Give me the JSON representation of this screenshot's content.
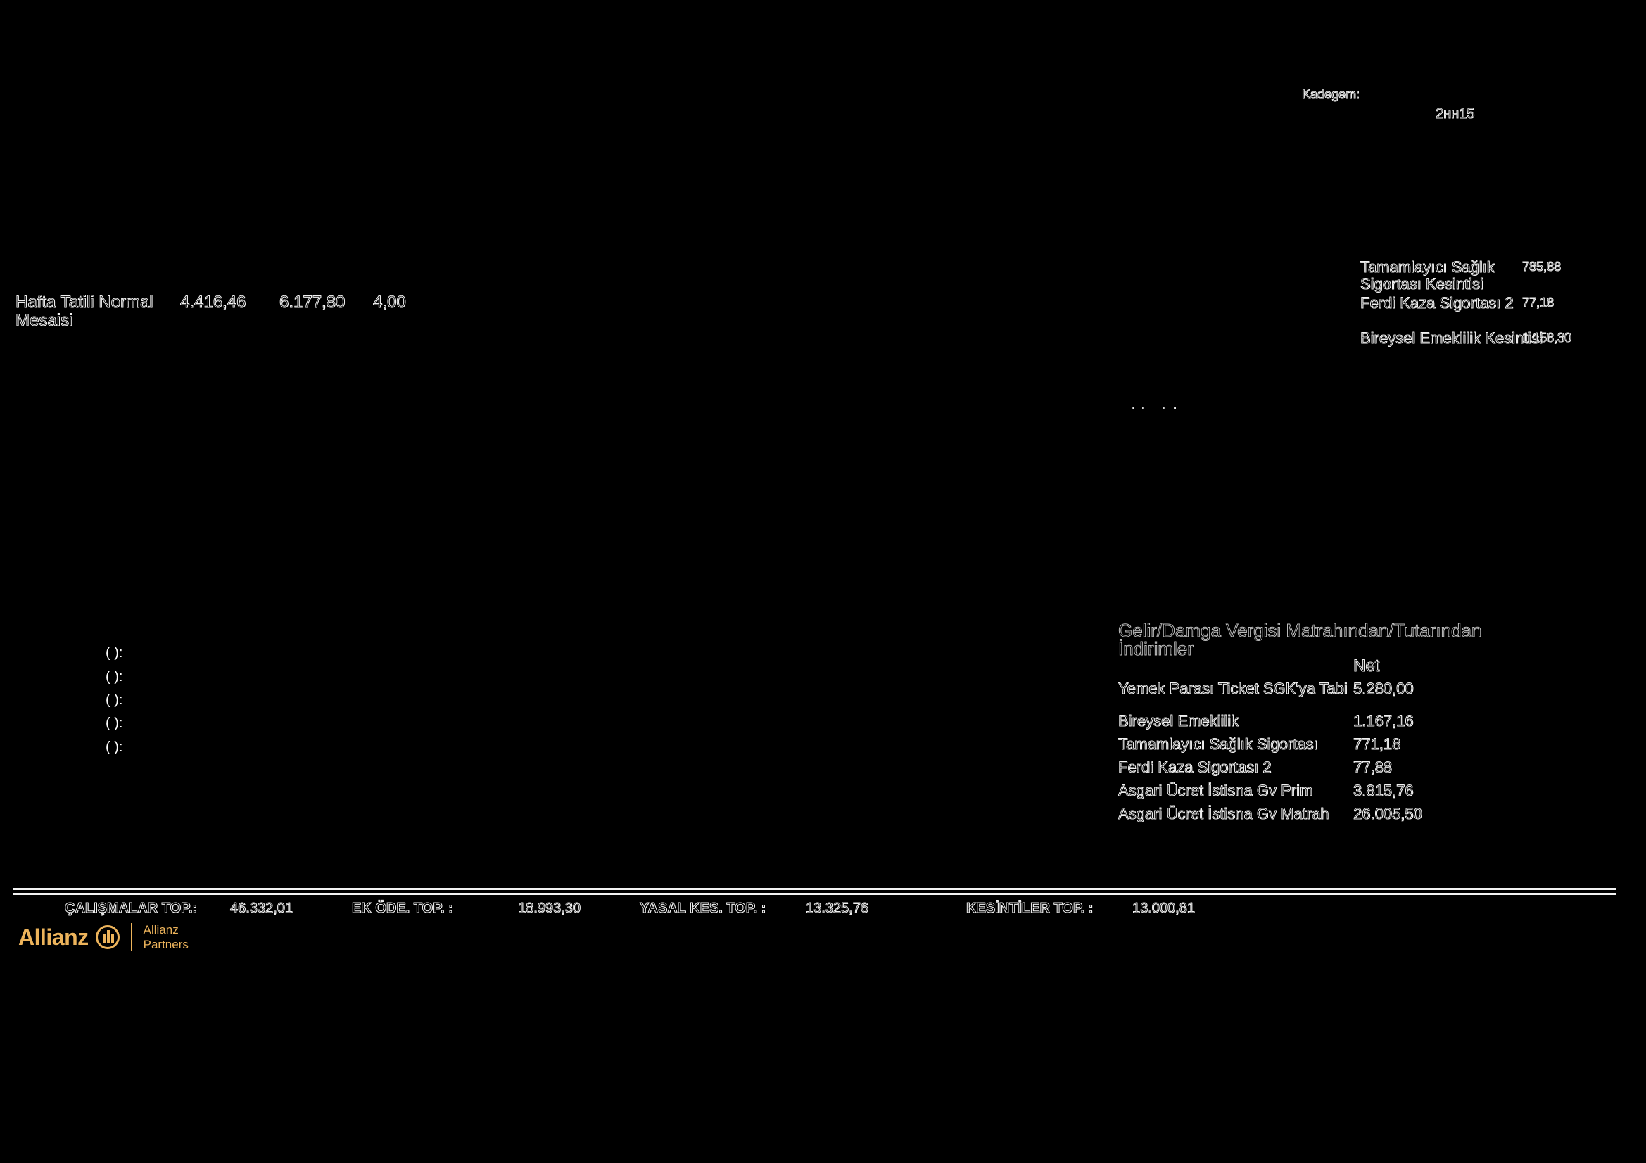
{
  "header": {
    "label_top": "Kadegem:",
    "label_code": "2нн15"
  },
  "earnings": {
    "rows": [
      {
        "label_line1": "Hafta Tatili Normal",
        "label_line2": "Mesaisi",
        "amount": "4.416,46",
        "amount2": "6.177,80",
        "count": "4,00"
      }
    ]
  },
  "deductions_right": {
    "rows": [
      {
        "label_line1": "Tamamlayıcı Sağlık",
        "label_line2": "Sigortası Kesintisi",
        "value": "785,88"
      },
      {
        "label_line1": "Ferdi Kaza Sigortası 2",
        "label_line2": "",
        "value": "77,18"
      },
      {
        "label_line1": "Bireysel Emeklilik Kesintisi",
        "label_line2": "",
        "value": "1.158,30"
      }
    ],
    "dots": ".. .."
  },
  "left_placeholders": [
    "(     ):",
    "(     ):",
    "(     ):",
    "(     ):",
    "(     ):"
  ],
  "tax_section": {
    "title_line1": "Gelir/Damga Vergisi Matrahından/Tutarından",
    "title_line2": "İndirimler",
    "net_header": "Net",
    "rows": [
      {
        "label": "Yemek Parası Ticket SGK'ya Tabi",
        "value": "5.280,00"
      },
      {
        "label": "Bireysel Emeklilik",
        "value": "1.167,16"
      },
      {
        "label": "Tamamlayıcı Sağlık Sigortası",
        "value": "771,18"
      },
      {
        "label": "Ferdi Kaza Sigortası 2",
        "value": "77,88"
      },
      {
        "label": "Asgari Ücret İstisna Gv Prim",
        "value": "3.815,76"
      },
      {
        "label": "Asgari Ücret İstisna Gv Matrah",
        "value": "26.005,50"
      }
    ]
  },
  "totals": [
    {
      "label": "ÇALIŞMALAR TOP.:",
      "value": "46.332,01"
    },
    {
      "label": "EK ÖDE. TOP. :",
      "value": "18.993,30"
    },
    {
      "label": "YASAL KES. TOP. :",
      "value": "13.325,76"
    },
    {
      "label": "KESİNTİLER TOP. :",
      "value": "13.000,81"
    }
  ],
  "logo": {
    "brand": "Allianz",
    "sub_line1": "Allianz",
    "sub_line2": "Partners",
    "color": "#ecb35b"
  }
}
